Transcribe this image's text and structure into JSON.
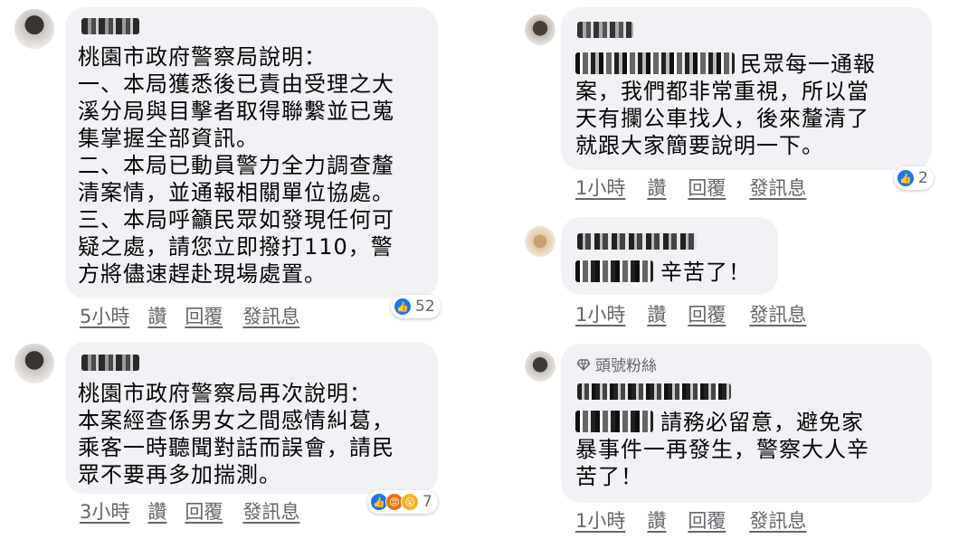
{
  "comments": [
    {
      "text": "桃園市政府警察局說明：\n一、本局獲悉後已責由受理之大\n溪分局與目擊者取得聯繫並已蒐\n集掌握全部資訊。\n二、本局已動員警力全力調查釐\n清案情，並通報相關單位協處。\n三、本局呼籲民眾如發現任何可\n疑之處，請您立即撥打110，警\n方將儘速趕赴現場處置。",
      "time": "5小時",
      "like": "讚",
      "reply": "回覆",
      "message": "發訊息",
      "reaction_count": "52"
    },
    {
      "text": "桃園市政府警察局再次說明：\n本案經查係男女之間感情糾葛，\n乘客一時聽聞對話而誤會，請民\n眾不要再多加揣測。",
      "time": "3小時",
      "like": "讚",
      "reply": "回覆",
      "message": "發訊息",
      "reaction_count": "7"
    },
    {
      "text_after_mention": "民眾每一通報\n案，我們都非常重視，所以當\n天有攔公車找人，後來釐清了\n就跟大家簡要說明一下。",
      "time": "1小時",
      "like": "讚",
      "reply": "回覆",
      "message": "發訊息",
      "reaction_count": "2"
    },
    {
      "text_after_mention": "辛苦了！",
      "time": "1小時",
      "like": "讚",
      "reply": "回覆",
      "message": "發訊息"
    },
    {
      "badge": "頭號粉絲",
      "text_after_mention": "請務必留意，避免家\n暴事件一再發生，警察大人辛\n苦了！",
      "time": "1小時",
      "like": "讚",
      "reply": "回覆",
      "message": "發訊息"
    }
  ],
  "icons": {
    "like": "like-reaction-icon",
    "angry": "angry-reaction-icon",
    "wow": "wow-reaction-icon",
    "fan_badge": "diamond-badge-icon"
  },
  "colors": {
    "bubble": "#f0f2f5",
    "meta_text": "#65676b",
    "like_blue": "#1877f2",
    "angry_orange": "#e9710f",
    "wow_yellow": "#f7b125"
  }
}
